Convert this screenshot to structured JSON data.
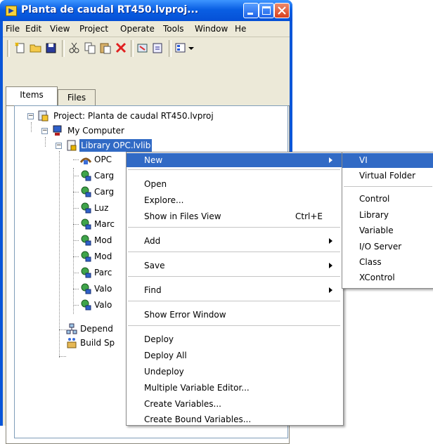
{
  "window": {
    "title": "Planta de caudal RT450.lvproj..."
  },
  "menubar": [
    "File",
    "Edit",
    "View",
    "Project",
    "Operate",
    "Tools",
    "Window",
    "He"
  ],
  "tabs": {
    "items": "Items",
    "files": "Files"
  },
  "tree": {
    "project": "Project: Planta de caudal RT450.lvproj",
    "computer": "My Computer",
    "library": "Library OPC.lvlib",
    "children": [
      "OPC",
      "Carg",
      "Carg",
      "Luz",
      "Marc",
      "Mod",
      "Mod",
      "Parc",
      "Valo",
      "Valo"
    ],
    "dependencies": "Depend",
    "build": "Build Sp"
  },
  "context_menu": {
    "new": "New",
    "open": "Open",
    "explore": "Explore...",
    "show_in_files": "Show in Files View",
    "show_in_files_shortcut": "Ctrl+E",
    "add": "Add",
    "save": "Save",
    "find": "Find",
    "show_error": "Show Error Window",
    "deploy": "Deploy",
    "deploy_all": "Deploy All",
    "undeploy": "Undeploy",
    "multi_var": "Multiple Variable Editor...",
    "create_vars": "Create Variables...",
    "create_bound": "Create Bound Variables..."
  },
  "submenu": [
    "VI",
    "Virtual Folder",
    "Control",
    "Library",
    "Variable",
    "I/O Server",
    "Class",
    "XControl"
  ],
  "colors": {
    "titlebar": "#0a5fe3",
    "selection": "#316ac5",
    "chrome": "#ece9d8"
  }
}
